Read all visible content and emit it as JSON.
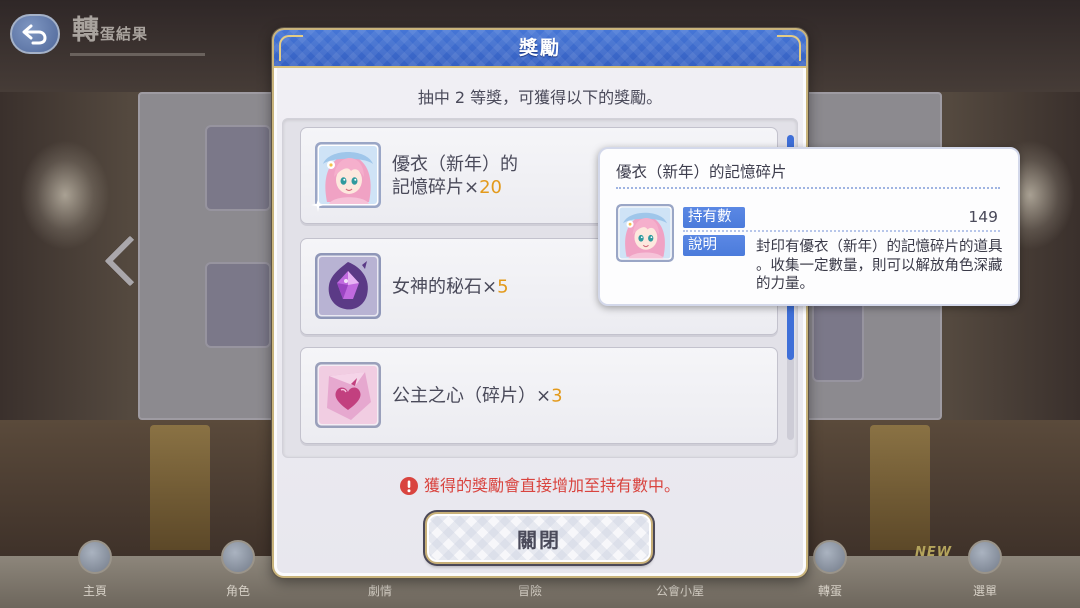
{
  "background": {
    "screen_title": "轉蛋結果",
    "nav_items": [
      {
        "label": "主頁",
        "icon": "home-icon"
      },
      {
        "label": "角色",
        "icon": "character-icon"
      },
      {
        "label": "劇情",
        "icon": "story-icon"
      },
      {
        "label": "冒險",
        "icon": "quest-icon"
      },
      {
        "label": "公會小屋",
        "icon": "guild-house-icon"
      },
      {
        "label": "轉蛋",
        "icon": "gacha-icon"
      },
      {
        "label": "選單",
        "icon": "menu-icon"
      }
    ],
    "new_badge": "NEW"
  },
  "dialog": {
    "title": "獎勵",
    "subtitle": "抽中 2 等獎，可獲得以下的獎勵。",
    "multiplier_sign": "×",
    "rewards": [
      {
        "name": "優衣（新年）的記憶碎片",
        "count": "20",
        "icon": "yui-new-year-memory-piece-icon"
      },
      {
        "name": "女神的秘石",
        "count": "5",
        "icon": "goddess-stone-icon"
      },
      {
        "name": "公主之心（碎片）",
        "count": "3",
        "icon": "princess-heart-fragment-icon"
      }
    ],
    "notice": "獲得的獎勵會直接增加至持有數中。",
    "close_label": "關閉"
  },
  "item_tooltip": {
    "title": "優衣（新年）的記憶碎片",
    "icon": "yui-new-year-memory-piece-icon",
    "owned_label": "持有數",
    "owned_value": "149",
    "description_label": "說明",
    "description": "封印有優衣（新年）的記憶碎片的道具。收集一定數量，則可以解放角色深藏的力量。"
  },
  "colors": {
    "header_blue": "#3560c2",
    "count_orange": "#e39a1c",
    "notice_red": "#d9443f",
    "label_blue": "#4b7bdb",
    "scrollbar_blue": "#3f6fd8"
  }
}
